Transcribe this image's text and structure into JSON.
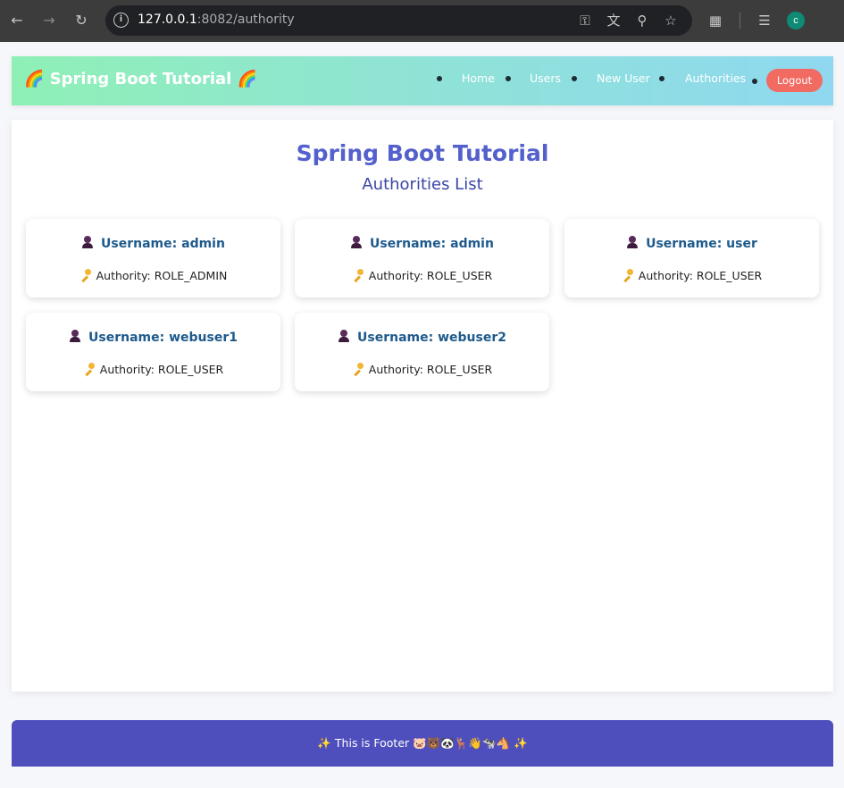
{
  "browser": {
    "url_host": "127.0.0.1",
    "url_port_path": ":8082/authority",
    "avatar_letter": "c",
    "icons": {
      "back": "back-arrow-icon",
      "forward": "forward-arrow-icon",
      "reload": "reload-icon",
      "site_info": "site-info-icon",
      "password": "key-icon",
      "translate": "translate-icon",
      "zoom": "zoom-icon",
      "bookmark": "star-icon",
      "extensions": "puzzle-icon",
      "media": "media-control-icon"
    }
  },
  "header": {
    "brand": "🌈 Spring Boot Tutorial 🌈",
    "nav": [
      {
        "label": "Home"
      },
      {
        "label": "Users"
      },
      {
        "label": "New User"
      },
      {
        "label": "Authorities"
      }
    ],
    "logout_label": "Logout"
  },
  "main": {
    "title": "Spring Boot Tutorial",
    "subtitle": "Authorities List",
    "cards": [
      {
        "username": "Username: admin",
        "authority": "Authority: ROLE_ADMIN"
      },
      {
        "username": "Username: admin",
        "authority": "Authority: ROLE_USER"
      },
      {
        "username": "Username: user",
        "authority": "Authority: ROLE_USER"
      },
      {
        "username": "Username: webuser1",
        "authority": "Authority: ROLE_USER"
      },
      {
        "username": "Username: webuser2",
        "authority": "Authority: ROLE_USER"
      }
    ]
  },
  "footer": {
    "text": "✨ This is Footer 🐷🐻🐼🦌👋🐄🐴 ✨"
  },
  "colors": {
    "header_gradient_start": "#8ff0b6",
    "header_gradient_end": "#8fd8f0",
    "logout_button": "#f26b62",
    "title": "#5460cc",
    "username": "#1e5a8c",
    "footer": "#4e4fbd"
  }
}
